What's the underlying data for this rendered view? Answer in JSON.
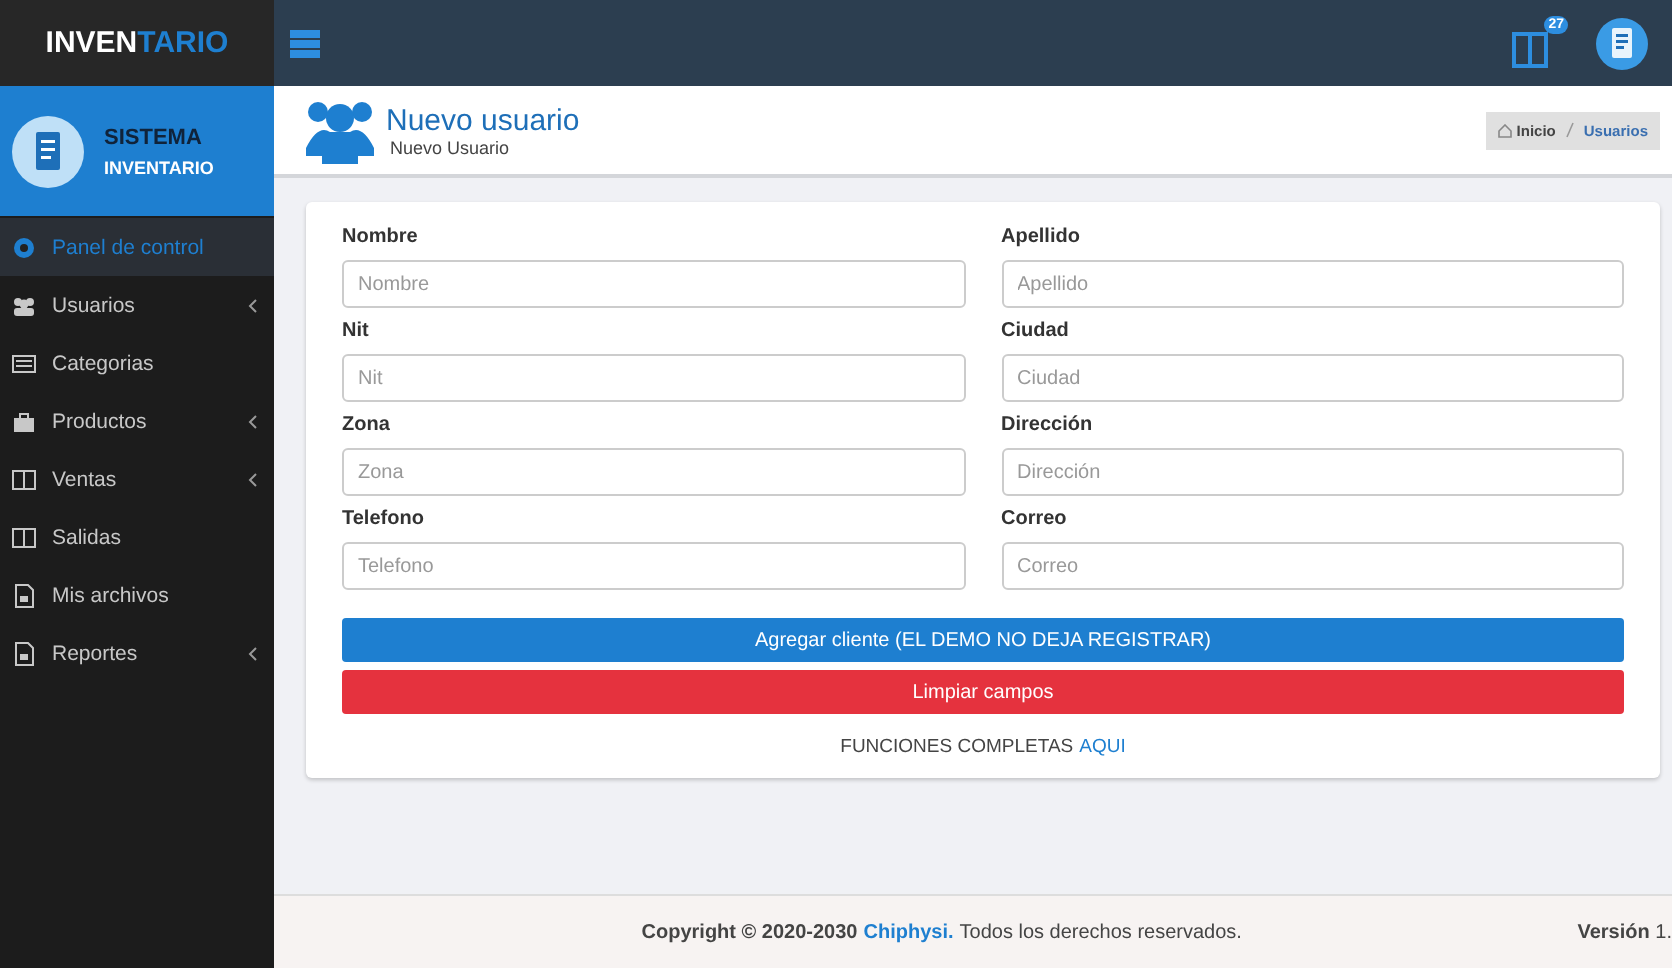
{
  "brand": {
    "part_1": "INVEN",
    "part_2": "TARIO"
  },
  "profile": {
    "line_1": "SISTEMA",
    "line_2": "INVENTARIO"
  },
  "sidebar": {
    "items": [
      {
        "label": "Panel de control",
        "kind": "dashboard",
        "selected": true,
        "expandable": false
      },
      {
        "label": "Usuarios",
        "kind": "users",
        "selected": false,
        "expandable": true
      },
      {
        "label": "Categorias",
        "kind": "list",
        "selected": false,
        "expandable": false
      },
      {
        "label": "Productos",
        "kind": "bag",
        "selected": false,
        "expandable": true
      },
      {
        "label": "Ventas",
        "kind": "columns",
        "selected": false,
        "expandable": true
      },
      {
        "label": "Salidas",
        "kind": "columns",
        "selected": false,
        "expandable": false
      },
      {
        "label": "Mis archivos",
        "kind": "file",
        "selected": false,
        "expandable": false
      },
      {
        "label": "Reportes",
        "kind": "file",
        "selected": false,
        "expandable": true
      }
    ]
  },
  "topbar": {
    "badge": "27"
  },
  "header": {
    "title": "Nuevo usuario",
    "subtitle": "Nuevo Usuario",
    "breadcrumb": [
      {
        "label": "Inicio",
        "selected": false
      },
      {
        "label": "Usuarios",
        "selected": true
      }
    ]
  },
  "form": {
    "fields": [
      {
        "label": "Nombre",
        "placeholder": "Nombre"
      },
      {
        "label": "Apellido",
        "placeholder": "Apellido"
      },
      {
        "label": "Nit",
        "placeholder": "Nit"
      },
      {
        "label": "Ciudad",
        "placeholder": "Ciudad"
      },
      {
        "label": "Zona",
        "placeholder": "Zona"
      },
      {
        "label": "Dirección",
        "placeholder": "Dirección"
      },
      {
        "label": "Telefono",
        "placeholder": "Telefono"
      },
      {
        "label": "Correo",
        "placeholder": "Correo"
      }
    ],
    "buttons": [
      {
        "label": "Agregar cliente (EL DEMO NO DEJA REGISTRAR)",
        "kind": "primary"
      },
      {
        "label": "Limpiar campos",
        "kind": "danger"
      }
    ],
    "note": "FUNCIONES COMPLETAS",
    "note_link": "AQUI"
  },
  "footer": {
    "copyright": "**Copyright © 2020-2030**",
    "link": "Chiphysi.",
    "rest": "Todos los derechos reservados.",
    "version": "**Versión** 1."
  }
}
